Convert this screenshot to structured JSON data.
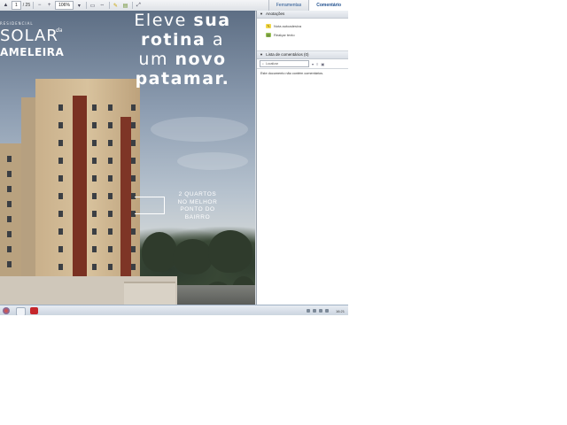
{
  "toolbar": {
    "page_current": "1",
    "page_total": "/ 25",
    "zoom": "106%",
    "tabs": [
      {
        "label": "Ferramentas"
      },
      {
        "label": "Comentário"
      }
    ]
  },
  "document": {
    "logo": {
      "small": "RESIDENCIAL",
      "main": "SOLAR",
      "connector": "da",
      "sub": "AMELEIRA"
    },
    "headline": {
      "line1": "Eleve",
      "line1_bold": "sua",
      "line2_bold": "rotina",
      "line2": "a",
      "line3": "um",
      "line3_bold": "novo",
      "line4_bold": "patamar."
    },
    "callout": {
      "line1": "2 QUARTOS",
      "line2": "NO MELHOR",
      "line3": "PONTO DO",
      "line4": "BAIRRO"
    }
  },
  "panel": {
    "annotations": {
      "header": "Anotações",
      "items": [
        {
          "label": "Nota autoadesiva"
        },
        {
          "label": "Realçar texto"
        }
      ]
    },
    "comments": {
      "header": "Lista de comentários (0)",
      "search_placeholder": "Localizar",
      "empty": "Este documento não contém comentários."
    }
  },
  "taskbar": {
    "clock": "16:21"
  },
  "colors": {
    "accent": "#1f4f8e",
    "brick": "#7a3122",
    "facade": "#d8c29d"
  }
}
